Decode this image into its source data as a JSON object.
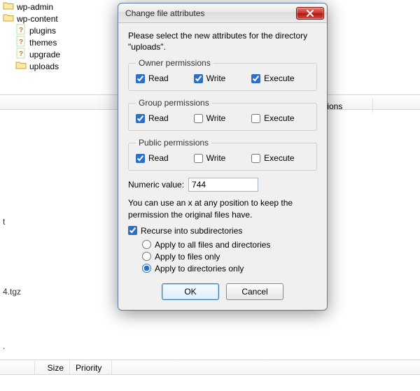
{
  "background": {
    "tree": [
      {
        "label": "wp-admin",
        "indent": false,
        "icon": "folder"
      },
      {
        "label": "wp-content",
        "indent": false,
        "icon": "folder"
      },
      {
        "label": "plugins",
        "indent": true,
        "icon": "php"
      },
      {
        "label": "themes",
        "indent": true,
        "icon": "php"
      },
      {
        "label": "upgrade",
        "indent": true,
        "icon": "php"
      },
      {
        "label": "uploads",
        "indent": true,
        "icon": "folder"
      }
    ],
    "col_permissions": "sions",
    "row_t_suffix": "t",
    "row_tgz_suffix": "4.tgz",
    "row_dot_suffix": ".",
    "col_size": "Size",
    "col_priority": "Priority"
  },
  "dialog": {
    "title": "Change file attributes",
    "intro": "Please select the new attributes for the directory \"uploads\".",
    "sections": {
      "owner": {
        "legend": "Owner permissions",
        "read": {
          "label": "Read",
          "checked": true
        },
        "write": {
          "label": "Write",
          "checked": true
        },
        "execute": {
          "label": "Execute",
          "checked": true
        }
      },
      "group": {
        "legend": "Group permissions",
        "read": {
          "label": "Read",
          "checked": true
        },
        "write": {
          "label": "Write",
          "checked": false
        },
        "execute": {
          "label": "Execute",
          "checked": false
        }
      },
      "public": {
        "legend": "Public permissions",
        "read": {
          "label": "Read",
          "checked": true
        },
        "write": {
          "label": "Write",
          "checked": false
        },
        "execute": {
          "label": "Execute",
          "checked": false
        }
      }
    },
    "numeric_label": "Numeric value:",
    "numeric_value": "744",
    "note": "You can use an x at any position to keep the permission the original files have.",
    "recurse": {
      "label": "Recurse into subdirectories",
      "checked": true
    },
    "apply": {
      "all": "Apply to all files and directories",
      "files": "Apply to files only",
      "dirs": "Apply to directories only",
      "selected": "dirs"
    },
    "buttons": {
      "ok": "OK",
      "cancel": "Cancel"
    }
  }
}
